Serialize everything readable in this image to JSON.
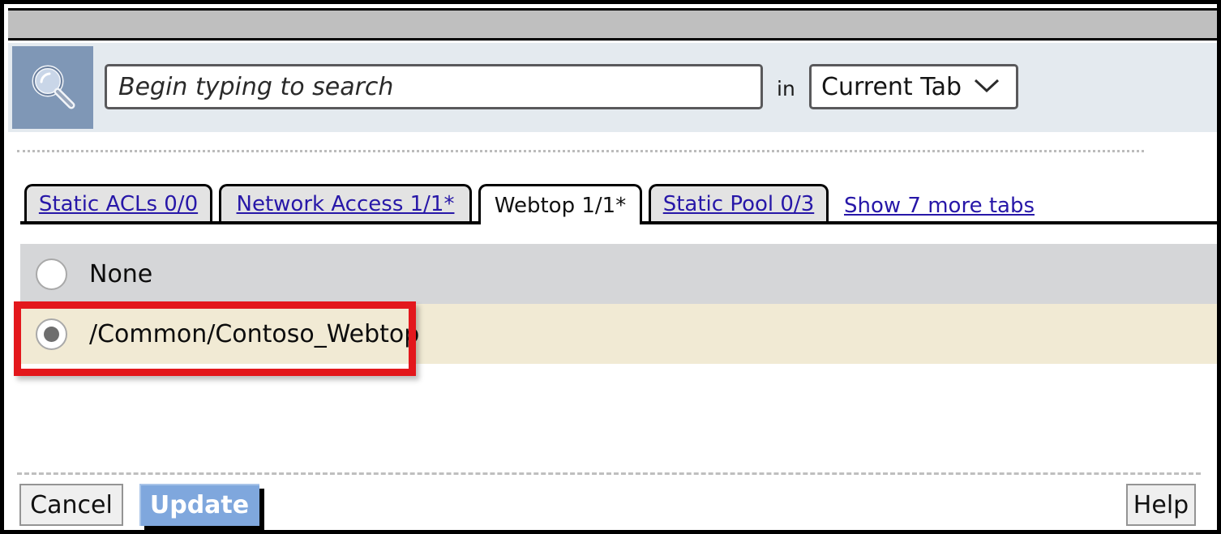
{
  "window": {
    "topbar_title": ""
  },
  "search": {
    "icon": "magnifier-icon",
    "value": "",
    "placeholder": "Begin typing to search",
    "in_label": "in",
    "scope_value": "Current Tab",
    "scope_caret": "chevron-down-icon"
  },
  "tabs": {
    "items": [
      {
        "label": "Static ACLs 0/0",
        "active": false
      },
      {
        "label": "Network Access 1/1*",
        "active": false
      },
      {
        "label": "Webtop 1/1*",
        "active": true
      },
      {
        "label": "Static Pool 0/3",
        "active": false
      }
    ],
    "show_more_label": "Show 7 more tabs"
  },
  "options": {
    "items": [
      {
        "label": "None",
        "checked": false,
        "highlighted": false
      },
      {
        "label": "/Common/Contoso_Webtop",
        "checked": true,
        "highlighted": true
      }
    ]
  },
  "footer": {
    "cancel_label": "Cancel",
    "update_label": "Update",
    "help_label": "Help"
  },
  "colors": {
    "topbar": "#bfbfbf",
    "search_strip": "#e4eaef",
    "search_icon_bg": "#7f97b6",
    "link": "#2717a8",
    "row_none_bg": "#d5d6d8",
    "row_selected_bg": "#f1ead4",
    "annotation_red": "#e3171c",
    "update_button": "#7fa7dd"
  }
}
